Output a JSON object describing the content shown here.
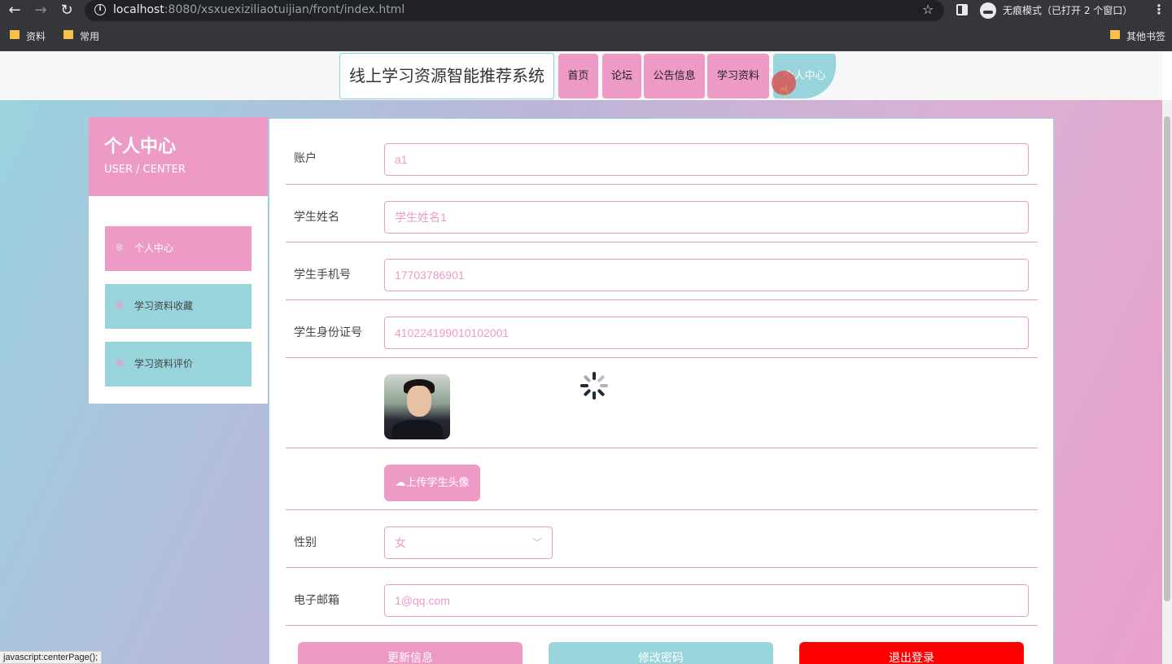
{
  "browser": {
    "url_host": "localhost",
    "url_rest": ":8080/xsxuexiziliaotuijian/front/index.html",
    "incognito_text": "无痕模式（已打开 2 个窗口）",
    "bookmarks": [
      "资料",
      "常用"
    ],
    "other_bookmarks": "其他书签",
    "status_text": "javascript:centerPage();"
  },
  "header": {
    "site_title": "线上学习资源智能推荐系统",
    "nav": [
      "首页",
      "论坛",
      "公告信息",
      "学习资料",
      "个人中心"
    ]
  },
  "sidebar": {
    "title": "个人中心",
    "subtitle": "USER / CENTER",
    "items": [
      {
        "label": "个人中心"
      },
      {
        "label": "学习资料收藏"
      },
      {
        "label": "学习资料评价"
      }
    ]
  },
  "form": {
    "account_label": "账户",
    "account_value": "a1",
    "name_label": "学生姓名",
    "name_value": "学生姓名1",
    "phone_label": "学生手机号",
    "phone_value": "17703786901",
    "idcard_label": "学生身份证号",
    "idcard_value": "410224199010102001",
    "upload_label": "上传学生头像",
    "gender_label": "性别",
    "gender_value": "女",
    "email_label": "电子邮箱",
    "email_value": "1@qq.com"
  },
  "actions": {
    "update": "更新信息",
    "change_password": "修改密码",
    "logout": "退出登录"
  },
  "colors": {
    "accent_pink": "#ee9ac7",
    "accent_teal": "#98d4dc",
    "logout_red": "#ff0000"
  }
}
